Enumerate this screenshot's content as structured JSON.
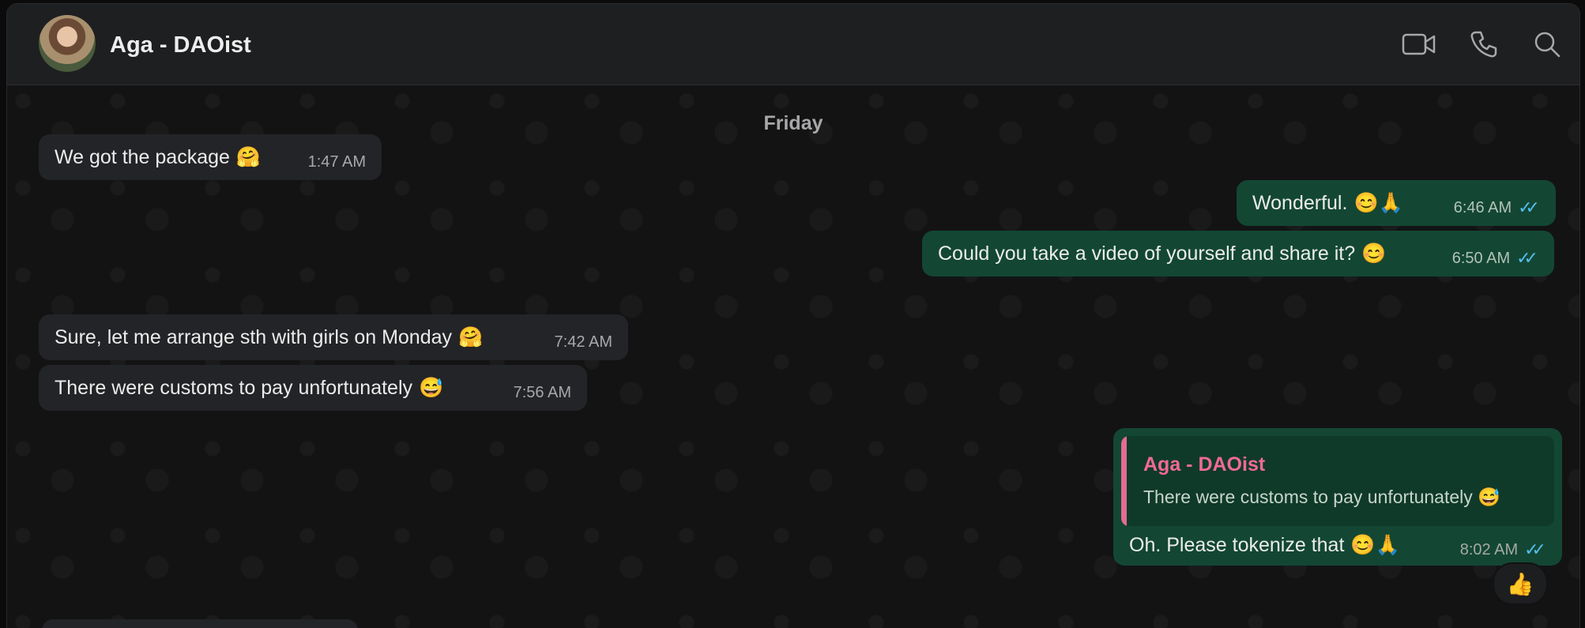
{
  "header": {
    "contact_name": "Aga - DAOist",
    "icons": [
      "video-call-icon",
      "phone-call-icon",
      "search-icon"
    ]
  },
  "chat": {
    "date_divider": "Friday",
    "messages": [
      {
        "direction": "in",
        "text": "We got the package",
        "emoji": "🤗",
        "time": "1:47 AM"
      },
      {
        "direction": "out",
        "text": "Wonderful.",
        "emoji": "😊🙏",
        "time": "6:46 AM",
        "status": "read"
      },
      {
        "direction": "out",
        "text": "Could you take a video of yourself and share it?",
        "emoji": "😊",
        "time": "6:50 AM",
        "status": "read"
      },
      {
        "direction": "in",
        "text": "Sure, let me arrange sth with girls on Monday",
        "emoji": "🤗",
        "time": "7:42 AM"
      },
      {
        "direction": "in",
        "text": "There were customs to pay unfortunately",
        "emoji": "😅",
        "time": "7:56 AM"
      }
    ],
    "reply_message": {
      "quoted_author": "Aga - DAOist",
      "quoted_text": "There were customs to pay unfortunately 😅",
      "text": "Oh. Please tokenize that",
      "emoji": "😊🙏",
      "time": "8:02 AM",
      "status": "read",
      "reaction": "👍"
    }
  },
  "colors": {
    "incoming_bubble": "#232427",
    "outgoing_bubble": "#134733",
    "read_ticks": "#53bdeb",
    "quote_accent": "#e46c94"
  }
}
